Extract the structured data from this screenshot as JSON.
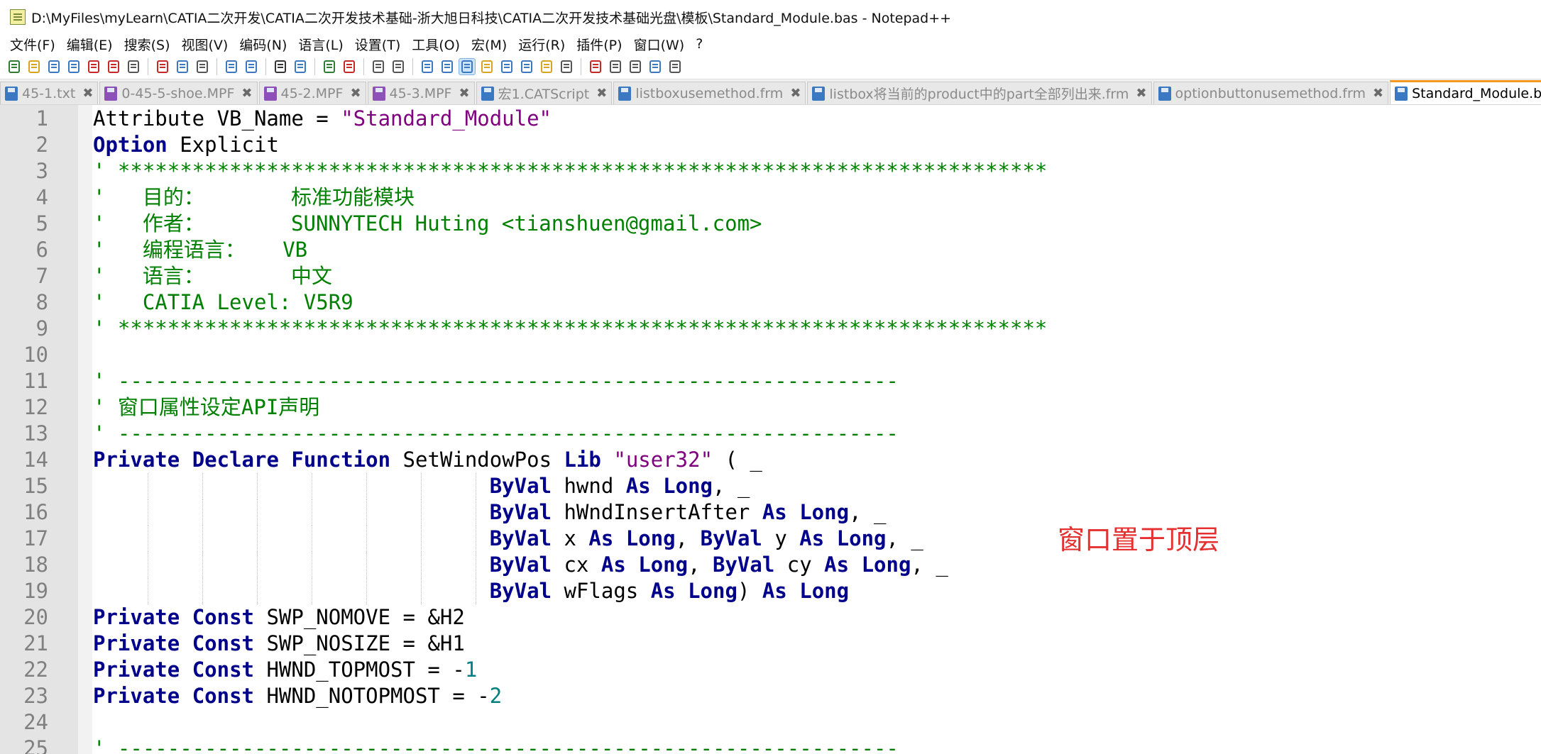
{
  "window": {
    "title": "D:\\MyFiles\\myLearn\\CATIA二次开发\\CATIA二次开发技术基础-浙大旭日科技\\CATIA二次开发技术基础光盘\\模板\\Standard_Module.bas - Notepad++"
  },
  "menu": [
    "文件(F)",
    "编辑(E)",
    "搜索(S)",
    "视图(V)",
    "编码(N)",
    "语言(L)",
    "设置(T)",
    "工具(O)",
    "宏(M)",
    "运行(R)",
    "插件(P)",
    "窗口(W)",
    "?"
  ],
  "tabs": [
    {
      "label": "45-1.txt",
      "modified": false
    },
    {
      "label": "0-45-5-shoe.MPF",
      "modified": true
    },
    {
      "label": "45-2.MPF",
      "modified": true
    },
    {
      "label": "45-3.MPF",
      "modified": true
    },
    {
      "label": "宏1.CATScript",
      "modified": false
    },
    {
      "label": "listboxusemethod.frm",
      "modified": false
    },
    {
      "label": "listbox将当前的product中的part全部列出来.frm",
      "modified": false
    },
    {
      "label": "optionbuttonusemethod.frm",
      "modified": false
    },
    {
      "label": "Standard_Module.bas",
      "modified": false,
      "active": true
    }
  ],
  "code_lines": [
    {
      "n": "1",
      "text": "Attribute VB_Name = \"Standard_Module\""
    },
    {
      "n": "2",
      "text": "Option Explicit"
    },
    {
      "n": "3",
      "text": "' ***************************************************************************"
    },
    {
      "n": "4",
      "text": "'   目的：       标准功能模块"
    },
    {
      "n": "5",
      "text": "'   作者：       SUNNYTECH Huting <tianshuen@gmail.com>"
    },
    {
      "n": "6",
      "text": "'   编程语言：   VB"
    },
    {
      "n": "7",
      "text": "'   语言：       中文"
    },
    {
      "n": "8",
      "text": "'   CATIA Level: V5R9"
    },
    {
      "n": "9",
      "text": "' ***************************************************************************"
    },
    {
      "n": "10",
      "text": ""
    },
    {
      "n": "11",
      "text": "' ---------------------------------------------------------------"
    },
    {
      "n": "12",
      "text": "' 窗口属性设定API声明"
    },
    {
      "n": "13",
      "text": "' ---------------------------------------------------------------"
    },
    {
      "n": "14",
      "text": "Private Declare Function SetWindowPos Lib \"user32\" ( _"
    },
    {
      "n": "15",
      "text": "                                ByVal hwnd As Long, _"
    },
    {
      "n": "16",
      "text": "                                ByVal hWndInsertAfter As Long, _"
    },
    {
      "n": "17",
      "text": "                                ByVal x As Long, ByVal y As Long, _"
    },
    {
      "n": "18",
      "text": "                                ByVal cx As Long, ByVal cy As Long, _"
    },
    {
      "n": "19",
      "text": "                                ByVal wFlags As Long) As Long"
    },
    {
      "n": "20",
      "text": "Private Const SWP_NOMOVE = &H2"
    },
    {
      "n": "21",
      "text": "Private Const SWP_NOSIZE = &H1"
    },
    {
      "n": "22",
      "text": "Private Const HWND_TOPMOST = -1"
    },
    {
      "n": "23",
      "text": "Private Const HWND_NOTOPMOST = -2"
    },
    {
      "n": "24",
      "text": ""
    },
    {
      "n": "25",
      "text": "' ---------------------------------------------------------------"
    }
  ],
  "annotation": "窗口置于顶层",
  "colors": {
    "keyword": "#00008b",
    "string": "#800080",
    "comment": "#008000",
    "number": "#008080",
    "annotation": "#e53030",
    "active_tab_accent": "#f39a1e"
  },
  "toolbar_icons": [
    "new-file-icon",
    "open-file-icon",
    "save-icon",
    "save-all-icon",
    "close-icon",
    "close-all-icon",
    "print-icon",
    "cut-icon",
    "copy-icon",
    "paste-icon",
    "undo-icon",
    "redo-icon",
    "find-icon",
    "replace-icon",
    "zoom-in-icon",
    "zoom-out-icon",
    "sync-v-icon",
    "sync-h-icon",
    "word-wrap-icon",
    "show-all-chars-icon",
    "indent-guide-icon",
    "udl-icon",
    "doc-map-icon",
    "function-list-icon",
    "folder-workspace-icon",
    "monitor-icon",
    "record-macro-icon",
    "stop-record-icon",
    "play-macro-icon",
    "run-macro-multiple-icon",
    "save-macro-icon"
  ]
}
